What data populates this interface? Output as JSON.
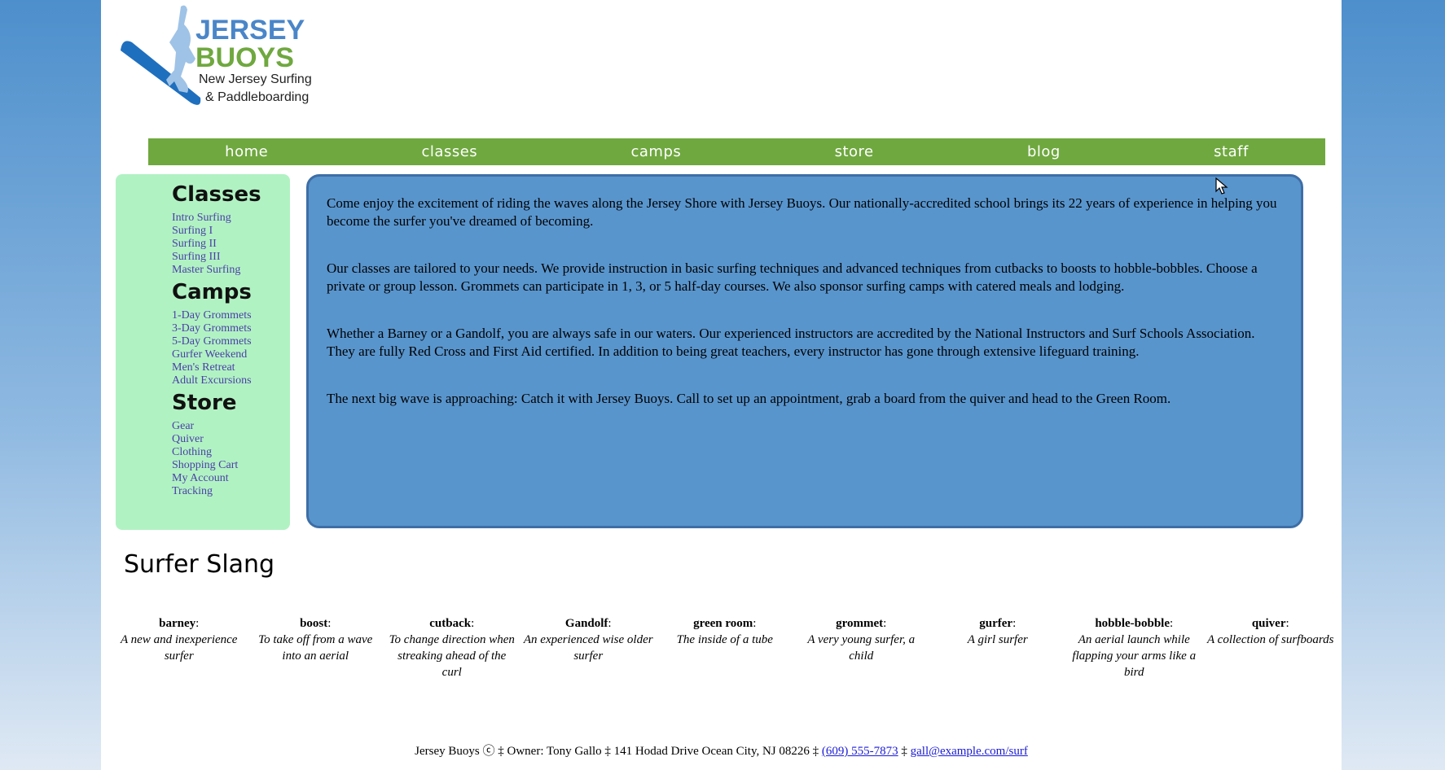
{
  "logo": {
    "line1": "JERSEY",
    "line2": "BUOYS",
    "line3": "New Jersey Surfing",
    "line4": "& Paddleboarding",
    "colors": {
      "blue": "#4a86c8",
      "green": "#6fa83f"
    },
    "icon": "surfer-icon"
  },
  "nav": [
    "home",
    "classes",
    "camps",
    "store",
    "blog",
    "staff"
  ],
  "sidebar": {
    "sections": [
      {
        "heading": "Classes",
        "links": [
          "Intro Surfing",
          "Surfing I",
          "Surfing II",
          "Surfing III",
          "Master Surfing"
        ]
      },
      {
        "heading": "Camps",
        "links": [
          "1-Day Grommets",
          "3-Day Grommets",
          "5-Day Grommets",
          "Gurfer Weekend",
          "Men's Retreat",
          "Adult Excursions"
        ]
      },
      {
        "heading": "Store",
        "links": [
          "Gear",
          "Quiver",
          "Clothing",
          "Shopping Cart",
          "My Account",
          "Tracking"
        ]
      }
    ]
  },
  "content": {
    "paragraphs": [
      "Come enjoy the excitement of riding the waves along the Jersey Shore with Jersey Buoys. Our nationally-accredited school brings its 22 years of experience in helping you become the surfer you've dreamed of becoming.",
      "Our classes are tailored to your needs. We provide instruction in basic surfing techniques and advanced techniques from cutbacks to boosts to hobble-bobbles. Choose a private or group lesson. Grommets can participate in 1, 3, or 5 half-day courses. We also sponsor surfing camps with catered meals and lodging.",
      "Whether a Barney or a Gandolf, you are always safe in our waters. Our experienced instructors are accredited by the National Instructors and Surf Schools Association. They are fully Red Cross and First Aid certified. In addition to being great teachers, every instructor has gone through extensive lifeguard training.",
      "The next big wave is approaching: Catch it with Jersey Buoys. Call to set up an appointment, grab a board from the quiver and head to the Green Room."
    ]
  },
  "slang": {
    "title": "Surfer Slang",
    "terms": [
      {
        "term": "barney",
        "def": "A new and inexperience surfer"
      },
      {
        "term": "boost",
        "def": "To take off from a wave into an aerial"
      },
      {
        "term": "cutback",
        "def": "To change direction when streaking ahead of the curl"
      },
      {
        "term": "Gandolf",
        "def": "An experienced wise older surfer"
      },
      {
        "term": "green room",
        "def": "The inside of a tube"
      },
      {
        "term": "grommet",
        "def": "A very young surfer, a child"
      },
      {
        "term": "gurfer",
        "def": "A girl surfer"
      },
      {
        "term": "hobble-bobble",
        "def": "An aerial launch while flapping your arms like a bird"
      },
      {
        "term": "quiver",
        "def": "A collection of surfboards"
      }
    ]
  },
  "footer": {
    "text_before": "Jersey Buoys ⓒ ‡ Owner: Tony Gallo ‡ 141 Hodad Drive Ocean City, NJ 08226 ‡ ",
    "phone": "(609) 555-7873",
    "separator": " ‡ ",
    "email": "gall@example.com/surf"
  }
}
